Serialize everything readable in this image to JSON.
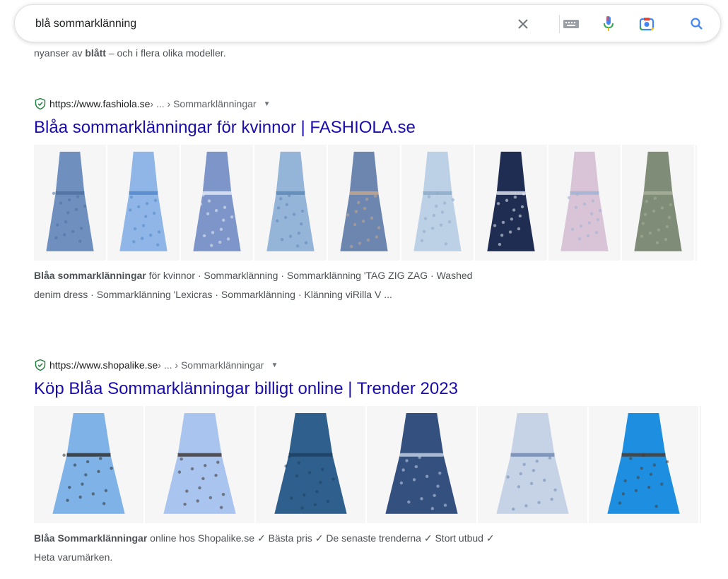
{
  "search": {
    "query": "blå sommarklänning"
  },
  "icons": {
    "clear": "close-icon",
    "keyboard": "keyboard-icon",
    "voice": "microphone-icon",
    "lens": "camera-lens-icon",
    "search": "search-icon"
  },
  "colors": {
    "link": "#1a0dab",
    "text": "#4d5156",
    "shield": "#188038"
  },
  "top_snippet": {
    "text": "nyanser av ",
    "bold": "blått",
    "rest": " – och i flera olika modeller."
  },
  "results": [
    {
      "host": "https://www.fashiola.se",
      "path": " › ... › Sommarklänningar",
      "title": "Blåa sommarklänningar för kvinnor | FASHIOLA.se",
      "desc_bold": "Blåa sommarklänningar",
      "desc_line1": " för kvinnor · Sommarklänning · Sommarklänning 'TAG ZIG ZAG · Washed",
      "desc_line2": "denim dress · Sommarklänning 'Lexicras · Sommarklänning · Klänning viRilla V ...",
      "thumb_count": 9
    },
    {
      "host": "https://www.shopalike.se",
      "path": " › ... › Sommarklänningar",
      "title": "Köp Blåa Sommarklänningar billigt online | Trender 2023",
      "desc_bold": "Blåa Sommarklänningar",
      "desc_line1": " online hos Shopalike.se ✓ Bästa pris ✓ De senaste trenderna ✓ Stort utbud ✓",
      "desc_line2": "Heta varumärken.",
      "thumb_count": 6
    }
  ]
}
